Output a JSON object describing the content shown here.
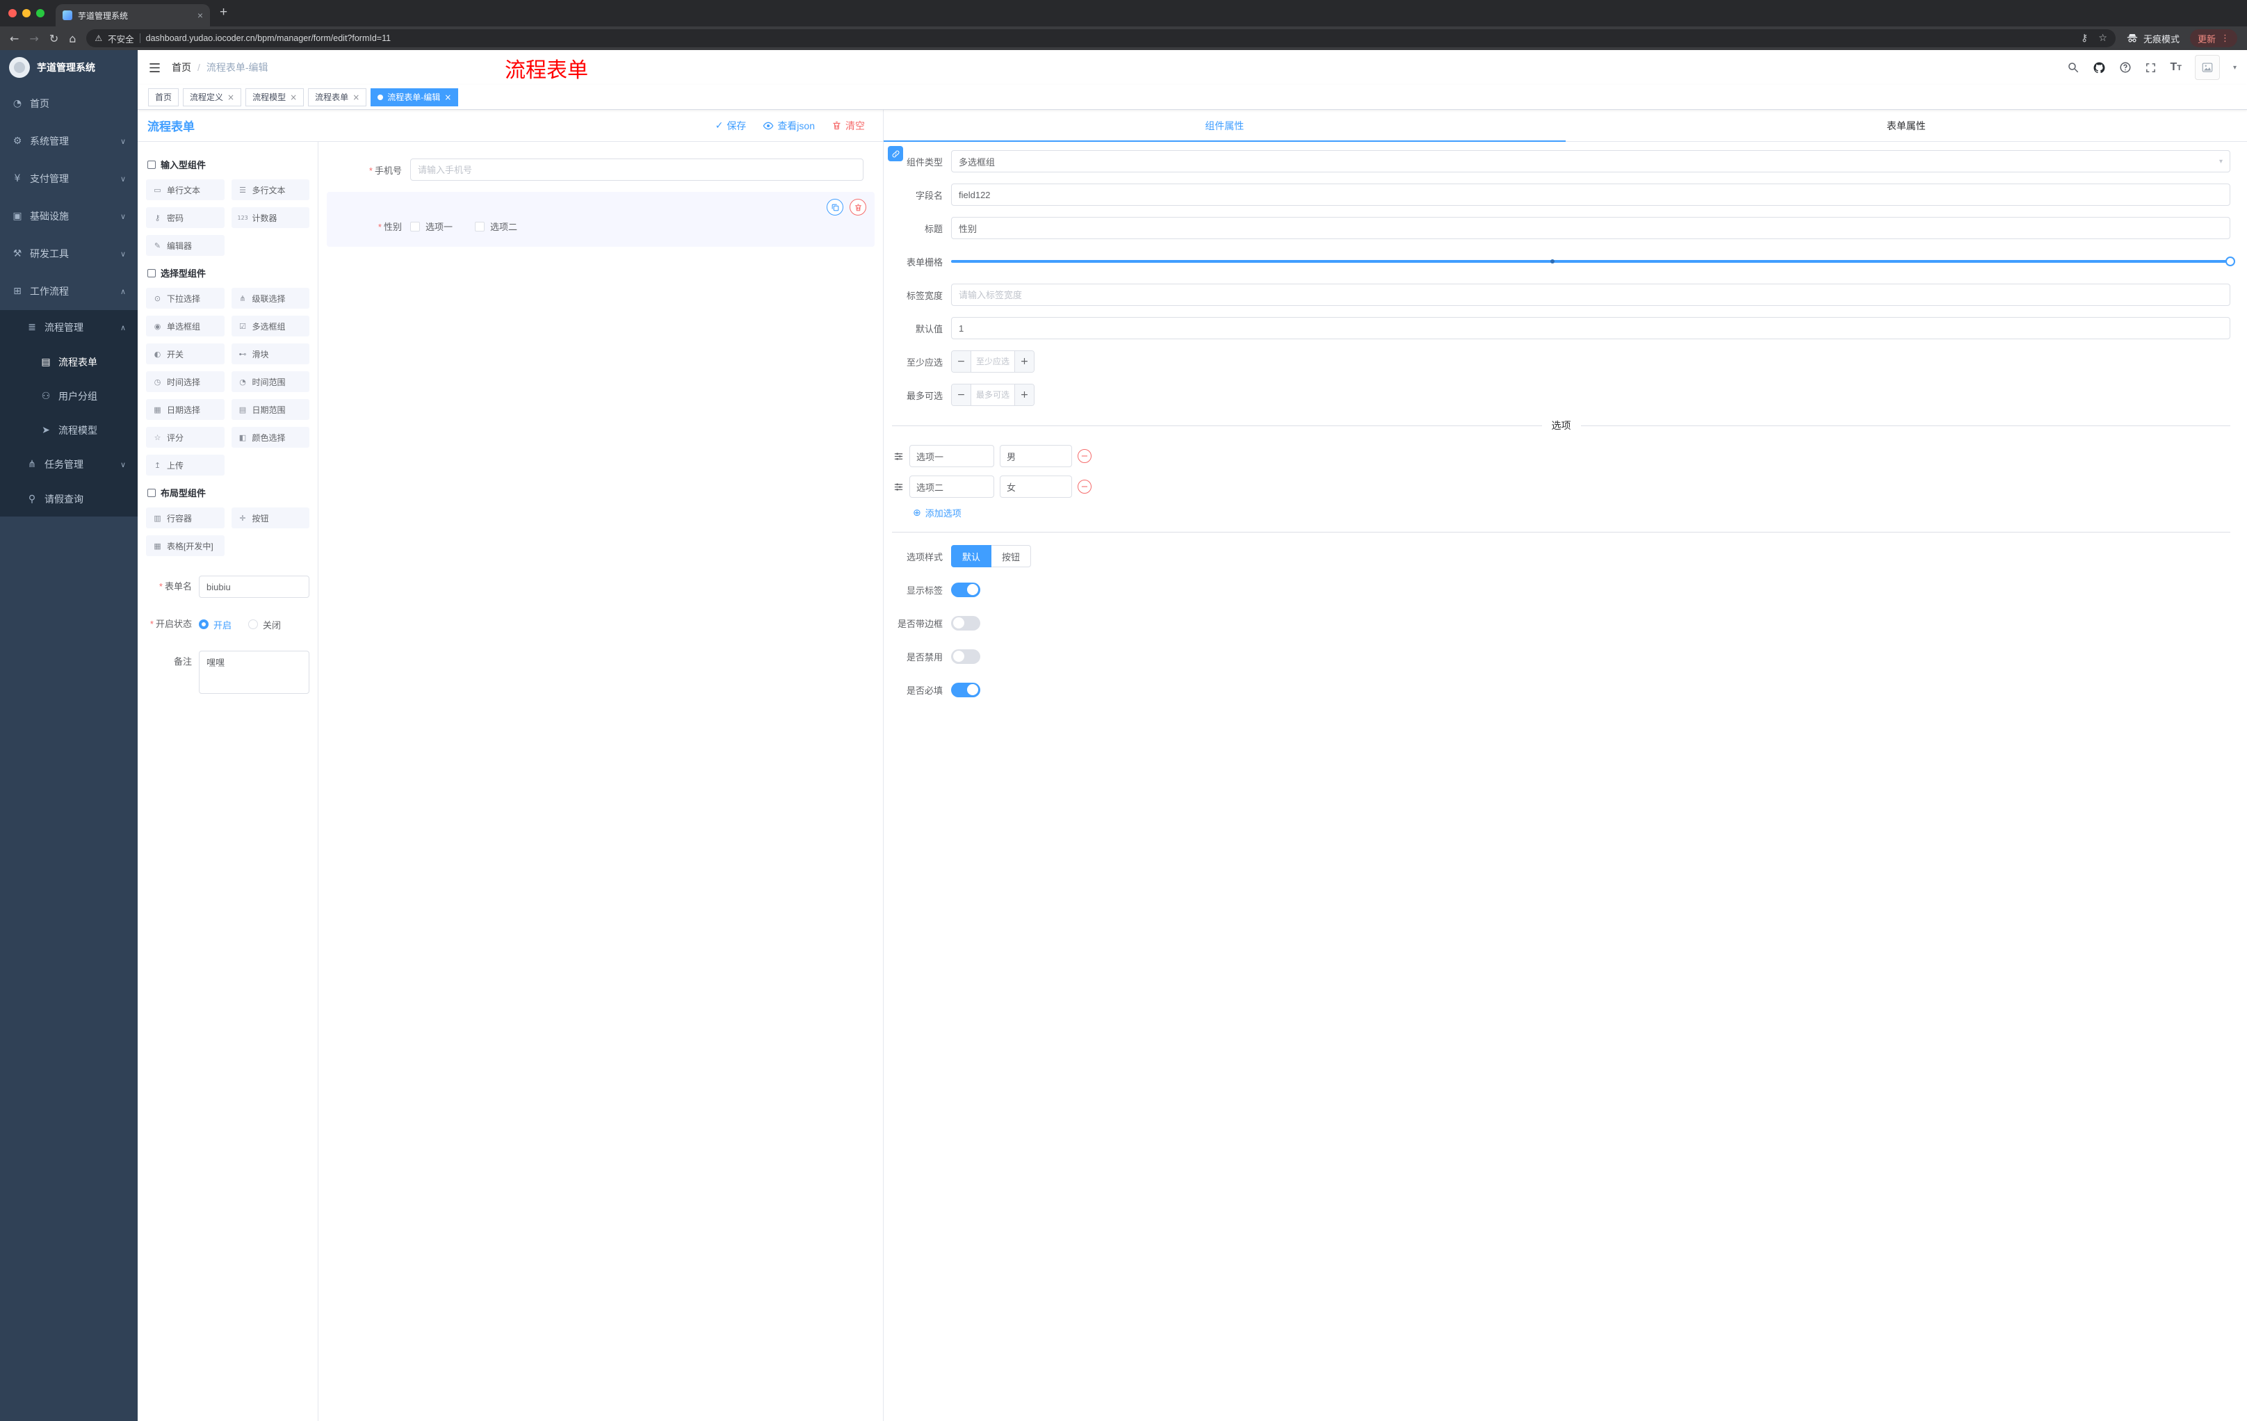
{
  "colors": {
    "accent": "#409eff",
    "danger": "#f56c6c",
    "sidebar_bg": "#304156",
    "submenu_bg": "#1f2d3d",
    "watermark": "#ff0000",
    "tag_active": "#409eff"
  },
  "browser": {
    "tab_title": "芋道管理系统",
    "security": "不安全",
    "url": "dashboard.yudao.iocoder.cn/bpm/manager/form/edit?formId=11",
    "incognito": "无痕模式",
    "update": "更新"
  },
  "icons": {
    "back": "←",
    "forward": "→",
    "reload": "↻",
    "home": "⌂",
    "warning": "⚠",
    "key": "⚷",
    "star": "☆",
    "more": "⋮",
    "plus_tab": "+",
    "close": "×",
    "caret": "▾",
    "select_caret": "▾",
    "check": "✓",
    "slash": "/",
    "minus": "−",
    "plus": "+",
    "add_circle": "⊕",
    "required": "*",
    "font_big": "T",
    "font_small": "T",
    "chevron_down": "∨",
    "chevron_up": "∧",
    "menu_home": "◔",
    "menu_system": "⚙",
    "menu_payment": "¥",
    "menu_infra": "▣",
    "menu_devtools": "⚒",
    "menu_workflow": "⊞",
    "menu_process_mgmt": "≣",
    "menu_process_form": "▤",
    "menu_user_group": "⚇",
    "menu_process_model": "➤",
    "menu_task_mgmt": "⋔",
    "menu_leave_query": "⚲",
    "single_text": "▭",
    "multi_text": "☰",
    "password": "⚷",
    "counter": "123",
    "editor": "✎",
    "select": "⊙",
    "cascader": "⋔",
    "radio_group": "◉",
    "checkbox_group": "☑",
    "switch": "◐",
    "slider": "⊷",
    "time_picker": "◷",
    "time_range": "◔",
    "date_picker": "▦",
    "date_range": "▤",
    "rate": "☆",
    "color_picker": "◧",
    "upload": "↥",
    "row_container": "▥",
    "button": "✛",
    "table_dev": "▦"
  },
  "sidebar": {
    "logo_title": "芋道管理系统",
    "home": "首页",
    "system": "系统管理",
    "payment": "支付管理",
    "infra": "基础设施",
    "devtools": "研发工具",
    "workflow": "工作流程",
    "process_mgmt": "流程管理",
    "process_form": "流程表单",
    "user_group": "用户分组",
    "process_model": "流程模型",
    "task_mgmt": "任务管理",
    "leave_query": "请假查询"
  },
  "header": {
    "breadcrumb_home": "首页",
    "breadcrumb_current": "流程表单-编辑",
    "watermark": "流程表单"
  },
  "tags": {
    "items": [
      "首页",
      "流程定义",
      "流程模型",
      "流程表单",
      "流程表单-编辑"
    ]
  },
  "designer": {
    "panel_title": "流程表单",
    "save": "保存",
    "view_json": "查看json",
    "clear": "清空",
    "groups": {
      "input_title": "输入型组件",
      "select_title": "选择型组件",
      "layout_title": "布局型组件"
    },
    "components": {
      "single_text": "单行文本",
      "multi_text": "多行文本",
      "password": "密码",
      "counter": "计数器",
      "editor": "编辑器",
      "select": "下拉选择",
      "cascader": "级联选择",
      "radio_group": "单选框组",
      "checkbox_group": "多选框组",
      "switch": "开关",
      "slider": "滑块",
      "time_picker": "时间选择",
      "time_range": "时间范围",
      "date_picker": "日期选择",
      "date_range": "日期范围",
      "rate": "评分",
      "color_picker": "颜色选择",
      "upload": "上传",
      "row_container": "行容器",
      "button": "按钮",
      "table_dev": "表格[开发中]"
    },
    "form_meta": {
      "name_label": "表单名",
      "name_value": "biubiu",
      "status_label": "开启状态",
      "status_on": "开启",
      "status_off": "关闭",
      "remark_label": "备注",
      "remark_value": "嘿嘿"
    },
    "canvas": {
      "phone_label": "手机号",
      "phone_placeholder": "请输入手机号",
      "gender_label": "性别",
      "gender_opt1": "选项一",
      "gender_opt2": "选项二"
    }
  },
  "props": {
    "tab_component": "组件属性",
    "tab_form": "表单属性",
    "component_type_label": "组件类型",
    "component_type_value": "多选框组",
    "field_name_label": "字段名",
    "field_name_value": "field122",
    "title_label": "标题",
    "title_value": "性别",
    "grid_label": "表单栅格",
    "label_width_label": "标签宽度",
    "label_width_placeholder": "请输入标签宽度",
    "default_label": "默认值",
    "default_value": "1",
    "min_label": "至少应选",
    "min_placeholder": "至少应选",
    "max_label": "最多可选",
    "max_placeholder": "最多可选",
    "options_title": "选项",
    "opt1_label": "选项一",
    "opt1_value": "男",
    "opt2_label": "选项二",
    "opt2_value": "女",
    "add_option": "添加选项",
    "option_style_label": "选项样式",
    "style_default": "默认",
    "style_button": "按钮",
    "show_label": "显示标签",
    "border_label": "是否带边框",
    "disabled_label": "是否禁用",
    "required_label": "是否必填"
  }
}
